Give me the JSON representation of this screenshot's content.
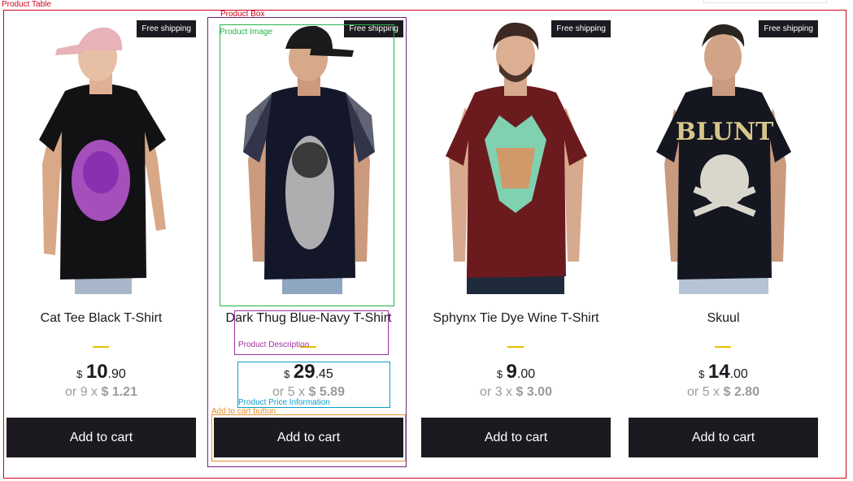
{
  "annotations": {
    "product_table": "Product Table",
    "product_box": "Product Box",
    "product_image": "Product Image",
    "product_description": "Product Description",
    "product_price_information": "Product Price Information",
    "add_to_cart_button": "Add to cart button"
  },
  "colors": {
    "product_table_outline": "#d0021b",
    "product_box_outline": "#7b1f7b",
    "product_image_outline": "#27b24a",
    "product_description_outline": "#a12fa3",
    "price_info_outline": "#0a9ccf",
    "cart_button_outline": "#e8902b",
    "accent_divider": "#eabf00",
    "button_bg": "#1b1a20",
    "muted_text": "#9c9b9b"
  },
  "products": [
    {
      "badge": "Free shipping",
      "title": "Cat Tee Black T-Shirt",
      "currency": "$",
      "price_int": "10",
      "price_dec": ".90",
      "installments": "or 9 x",
      "installment_value": "$ 1.21",
      "button": "Add to cart",
      "shirt_color": "#121214",
      "print_color": "#c05bd9",
      "cap_color": "#e7b2b8"
    },
    {
      "badge": "Free shipping",
      "title": "Dark Thug Blue-Navy T-Shirt",
      "currency": "$",
      "price_int": "29",
      "price_dec": ".45",
      "installments": "or 5 x",
      "installment_value": "$ 5.89",
      "button": "Add to cart",
      "shirt_color": "#14172a",
      "print_color": "#c9c9c9",
      "cap_color": "#1a1a1a"
    },
    {
      "badge": "Free shipping",
      "title": "Sphynx Tie Dye Wine T-Shirt",
      "currency": "$",
      "price_int": "9",
      "price_dec": ".00",
      "installments": "or 3 x",
      "installment_value": "$ 3.00",
      "button": "Add to cart",
      "shirt_color": "#6b1a1e",
      "print_color": "#7fd1b0",
      "cap_color": ""
    },
    {
      "badge": "Free shipping",
      "title": "Skuul",
      "currency": "$",
      "price_int": "14",
      "price_dec": ".00",
      "installments": "or 5 x",
      "installment_value": "$ 2.80",
      "button": "Add to cart",
      "shirt_color": "#141620",
      "print_color": "#d8c58a",
      "cap_color": ""
    }
  ]
}
